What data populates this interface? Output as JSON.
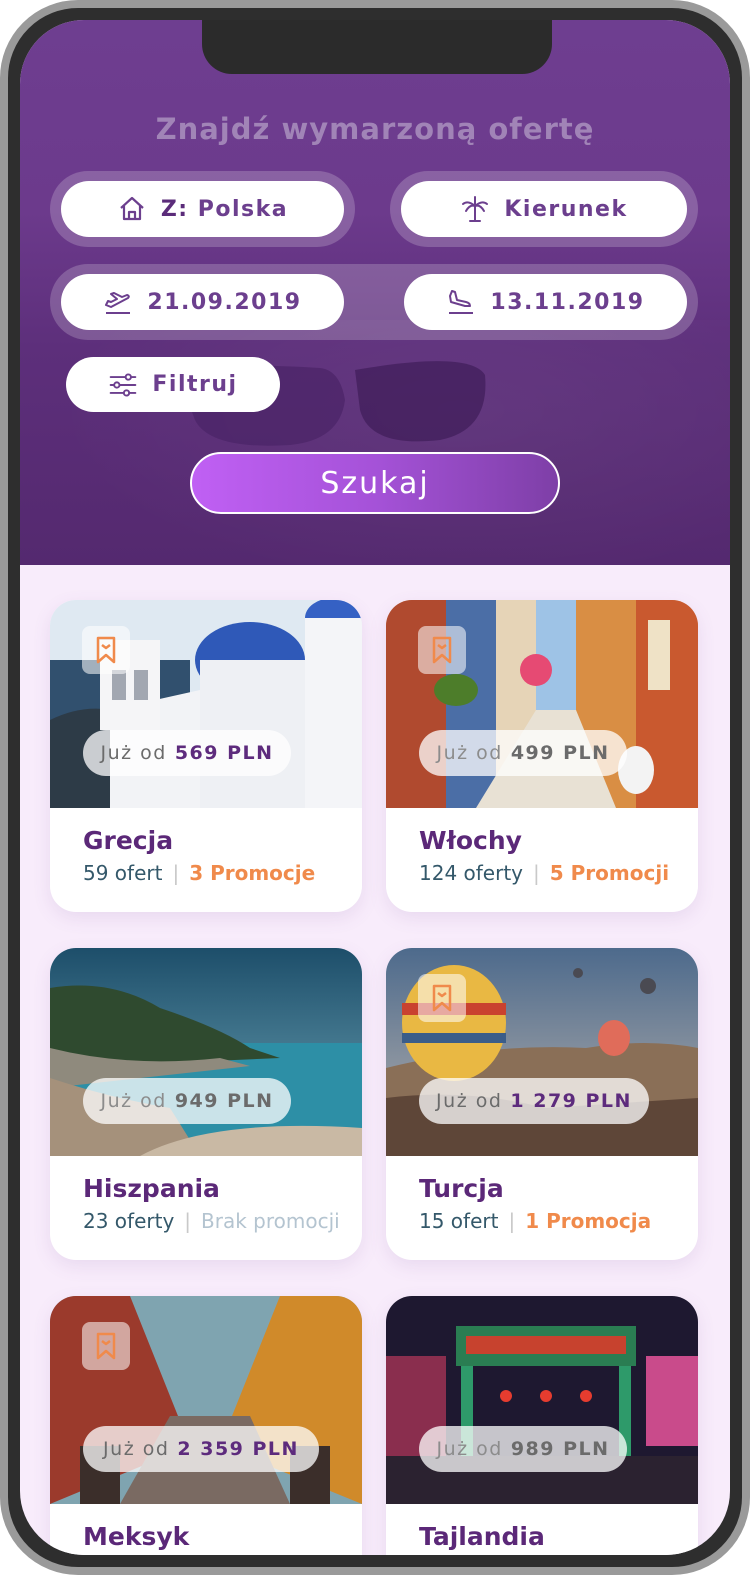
{
  "header": {
    "title": "Znajdź wymarzoną ofertę"
  },
  "search": {
    "from_prefix": "Z:",
    "from_value": "Polska",
    "destination": "Kierunek",
    "departure_date": "21.09.2019",
    "return_date": "13.11.2019",
    "filter_label": "Filtruj",
    "submit_label": "Szukaj"
  },
  "offers": [
    {
      "country": "Grecja",
      "price_prefix": "Już od",
      "price": "569 PLN",
      "offers": "59 ofert",
      "promos": "3 Promocje",
      "bookmarked": true
    },
    {
      "country": "Włochy",
      "price_prefix": "Już od",
      "price": "499 PLN",
      "offers": "124 oferty",
      "promos": "5 Promocji",
      "bookmarked": true
    },
    {
      "country": "Hiszpania",
      "price_prefix": "Już od",
      "price": "949 PLN",
      "offers": "23 oferty",
      "promos": "Brak promocji",
      "bookmarked": false
    },
    {
      "country": "Turcja",
      "price_prefix": "Już od",
      "price": "1 279 PLN",
      "offers": "15 ofert",
      "promos": "1 Promocja",
      "bookmarked": true
    },
    {
      "country": "Meksyk",
      "price_prefix": "Już od",
      "price": "2 359 PLN",
      "offers": "",
      "promos": "",
      "bookmarked": true
    },
    {
      "country": "Tajlandia",
      "price_prefix": "Już od",
      "price": "989 PLN",
      "offers": "",
      "promos": "",
      "bookmarked": false
    }
  ],
  "colors": {
    "primary": "#5b2878",
    "accent_gradient_start": "#c060f4",
    "promo": "#f08a4b"
  }
}
